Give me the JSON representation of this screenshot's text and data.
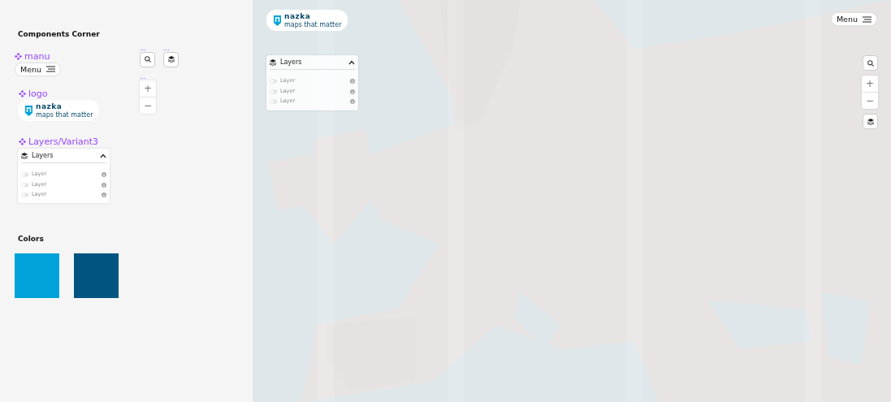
{
  "components_corner": {
    "title": "Components Corner",
    "menu_component": {
      "label": "manu",
      "button": "Menu"
    },
    "logo_component": {
      "label": "logo",
      "brand": "nazka",
      "tagline": "maps that matter"
    },
    "layers_component": {
      "label": "Layers/Variant3",
      "title": "Layers",
      "expanded": true,
      "layers": [
        {
          "label": "Layer",
          "on": false
        },
        {
          "label": "Layer",
          "on": false
        },
        {
          "label": "Layer",
          "on": false
        }
      ]
    },
    "mini_components": [
      {
        "label": "...",
        "kind": "search"
      },
      {
        "label": "...",
        "kind": "layers"
      },
      {
        "label": "...",
        "kind": "zoom",
        "zoom_in": "+",
        "zoom_out": "−"
      }
    ]
  },
  "colors": {
    "title": "Colors",
    "swatches": [
      {
        "color": "#00a3d9"
      },
      {
        "color": "#005580"
      }
    ]
  },
  "map_preview": {
    "logo": {
      "brand": "nazka",
      "tagline": "maps that matter"
    },
    "layers_panel": {
      "title": "Layers",
      "expanded": true,
      "layers": [
        {
          "label": "Layer",
          "on": false
        },
        {
          "label": "Layer",
          "on": false
        },
        {
          "label": "Layer",
          "on": false
        }
      ]
    },
    "menu_button": "Menu",
    "zoom_in": "+",
    "zoom_out": "−"
  }
}
